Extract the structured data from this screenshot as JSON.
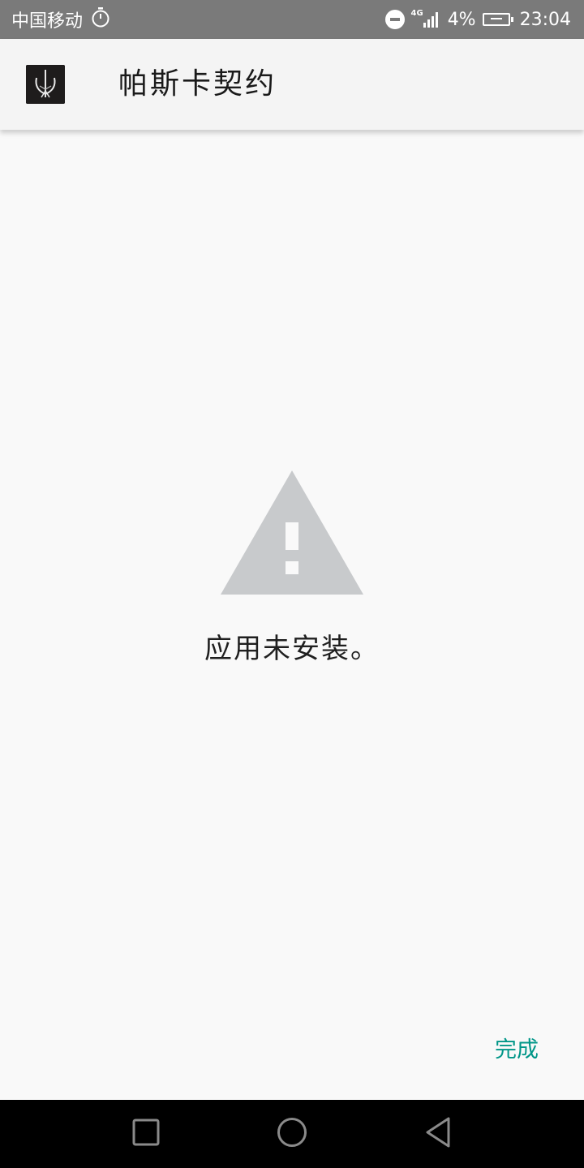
{
  "status_bar": {
    "carrier": "中国移动",
    "network_type": "4G",
    "battery_percent": "4%",
    "time": "23:04",
    "icons": [
      "stopwatch-icon",
      "do-not-disturb-icon",
      "signal-icon",
      "battery-charging-icon"
    ]
  },
  "app_bar": {
    "title": "帕斯卡契约",
    "icon": "app-logo-icon"
  },
  "main": {
    "warning_icon": "warning-triangle-icon",
    "message": "应用未安装。",
    "done_label": "完成"
  },
  "nav_bar": {
    "recents": "recents-square-icon",
    "home": "home-circle-icon",
    "back": "back-triangle-icon"
  },
  "colors": {
    "status_bar_bg": "#7a7a7a",
    "app_bar_bg": "#f4f4f4",
    "page_bg": "#f9f9f9",
    "accent": "#009688",
    "warning_icon": "#c8cacc",
    "nav_bar_bg": "#000000"
  }
}
